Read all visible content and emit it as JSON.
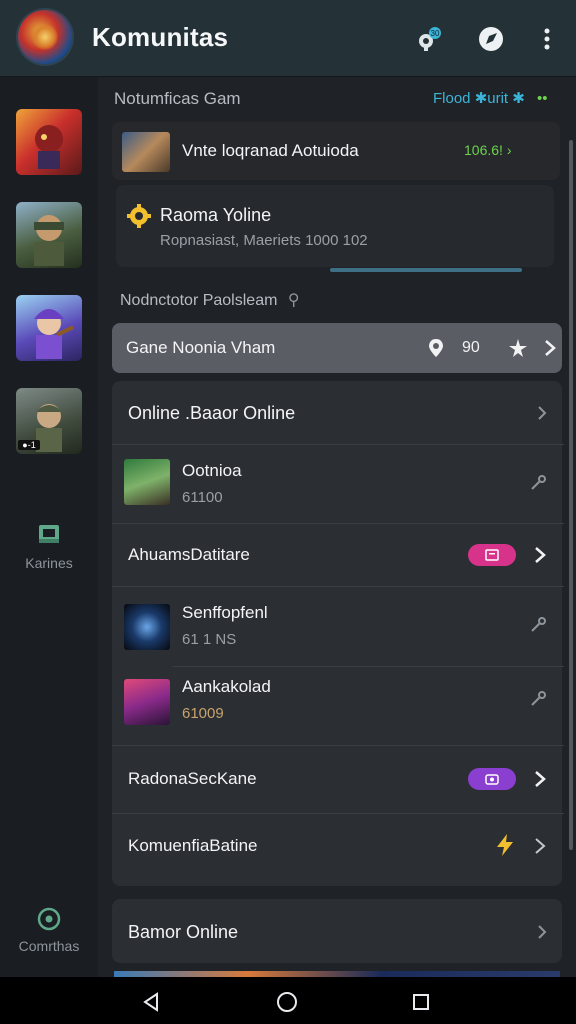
{
  "appbar": {
    "title": "Komunitas"
  },
  "sidebar": {
    "label_middle": "Karines",
    "label_bottom": "Comrthas"
  },
  "feed_header": {
    "title": "Notumficas Gam",
    "right_label": "Flood ✱urit ✱",
    "right_dots": "••"
  },
  "feed": {
    "top_item": {
      "title": "Vnte loqranad Aotuioda",
      "badge": "106.6! ›"
    },
    "card": {
      "title": "Raoma Yoline",
      "subtitle": "Ropnasiast, Maeriets 1000 102"
    }
  },
  "section2": {
    "title": "Nodnctotor Paolsleam",
    "highlight": {
      "label": "Gane Noonia Vham",
      "count": "90"
    }
  },
  "list": {
    "online": "Online .Baaor Online",
    "game1": {
      "title": "Ootnioa",
      "sub": "61100"
    },
    "achievements": "AhuamsDatitare",
    "game2": {
      "title": "Senffopfenl",
      "sub": "61 1 NS"
    },
    "game3": {
      "title": "Aankakolad",
      "sub": "61009"
    },
    "radio": "RadonaSecKane",
    "community": "KomuenfiaBatine"
  },
  "bottom_card": {
    "label": "Bamor Online"
  },
  "colors": {
    "accent_blue": "#3cb4d8",
    "accent_green": "#6bd44a",
    "pill_pink": "#d8338a",
    "pill_purple": "#8a3fd0",
    "lightning": "#f2c02e"
  }
}
